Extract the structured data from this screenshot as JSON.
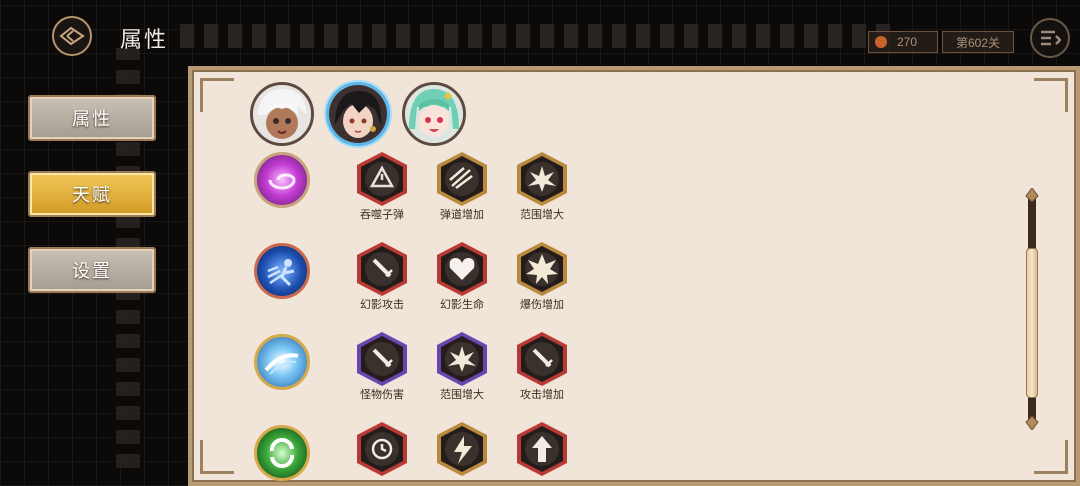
{
  "header": {
    "title": "属性",
    "energy": "270",
    "stage": "第602关"
  },
  "tabs": [
    {
      "label": "属性",
      "state": "normal"
    },
    {
      "label": "天赋",
      "state": "selected"
    },
    {
      "label": "设置",
      "state": "normal"
    }
  ],
  "characters": [
    {
      "name_icon": "white-haired-girl-portrait",
      "selected": false
    },
    {
      "name_icon": "dark-haired-girl-portrait",
      "selected": true
    },
    {
      "name_icon": "green-haired-girl-portrait",
      "selected": false
    }
  ],
  "skill_rows": [
    {
      "skill_icon": "purple-vortex-icon",
      "talents": [
        {
          "label": "吞噬子弹",
          "frame": "red",
          "icon": "warning-triangle-icon"
        },
        {
          "label": "弹道增加",
          "frame": "gold",
          "icon": "triple-streak-icon"
        },
        {
          "label": "范围增大",
          "frame": "gold",
          "icon": "burst-spikes-icon"
        }
      ]
    },
    {
      "skill_icon": "blue-dash-icon",
      "talents": [
        {
          "label": "幻影攻击",
          "frame": "red",
          "icon": "sword-icon"
        },
        {
          "label": "幻影生命",
          "frame": "red",
          "icon": "heart-icon"
        },
        {
          "label": "爆伤增加",
          "frame": "gold",
          "icon": "explosion-icon"
        }
      ]
    },
    {
      "skill_icon": "ice-slash-icon",
      "talents": [
        {
          "label": "怪物伤害",
          "frame": "purple",
          "icon": "sword-icon"
        },
        {
          "label": "范围增大",
          "frame": "purple",
          "icon": "burst-spikes-icon"
        },
        {
          "label": "攻击增加",
          "frame": "red",
          "icon": "sword-icon"
        }
      ]
    },
    {
      "skill_icon": "green-cycle-icon",
      "talents": [
        {
          "label": "",
          "frame": "red",
          "icon": "clock-icon"
        },
        {
          "label": "",
          "frame": "gold",
          "icon": "lightning-icon"
        },
        {
          "label": "",
          "frame": "red",
          "icon": "arrow-up-icon"
        }
      ]
    }
  ],
  "colors": {
    "frame_red": "#b93a34",
    "frame_gold": "#b98a3e",
    "frame_purple": "#6a45b0",
    "tab_selected": "#e6b13b",
    "panel_bg": "#f0e5d8"
  }
}
